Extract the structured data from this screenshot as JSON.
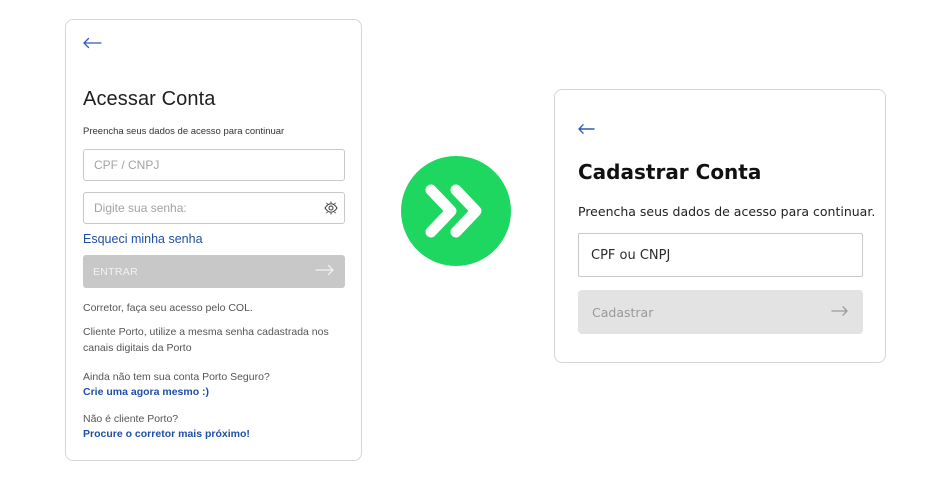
{
  "login_card": {
    "title": "Acessar Conta",
    "subtitle": "Preencha seus dados de acesso para continuar",
    "cpf_placeholder": "CPF / CNPJ",
    "password_placeholder": "Digite sua senha:",
    "forgot_password": "Esqueci minha senha",
    "submit_label": "ENTRAR",
    "corretor_text": "Corretor, faça seu acesso pelo COL.",
    "cliente_text": "Cliente Porto, utilize a mesma senha cadastrada nos canais digitais da Porto",
    "no_account_text": "Ainda não tem sua conta Porto Seguro?",
    "create_account_link": "Crie uma agora mesmo :)",
    "not_client_text": "Não é cliente Porto?",
    "find_broker_link": "Procure o corretor mais próximo!"
  },
  "register_card": {
    "title": "Cadastrar Conta",
    "subtitle": "Preencha seus dados de acesso para continuar.",
    "cpf_placeholder": "CPF ou CNPJ",
    "submit_label": "Cadastrar"
  },
  "icons": {
    "back": "arrow-left-icon",
    "password_visibility": "eye-icon",
    "submit_arrow": "arrow-right-icon",
    "transition": "double-chevron-right-icon"
  },
  "colors": {
    "link": "#1f4fa8",
    "accent_green": "#1ed760",
    "disabled_button_left": "#c8c8c8",
    "disabled_button_right": "#e3e3e3"
  }
}
